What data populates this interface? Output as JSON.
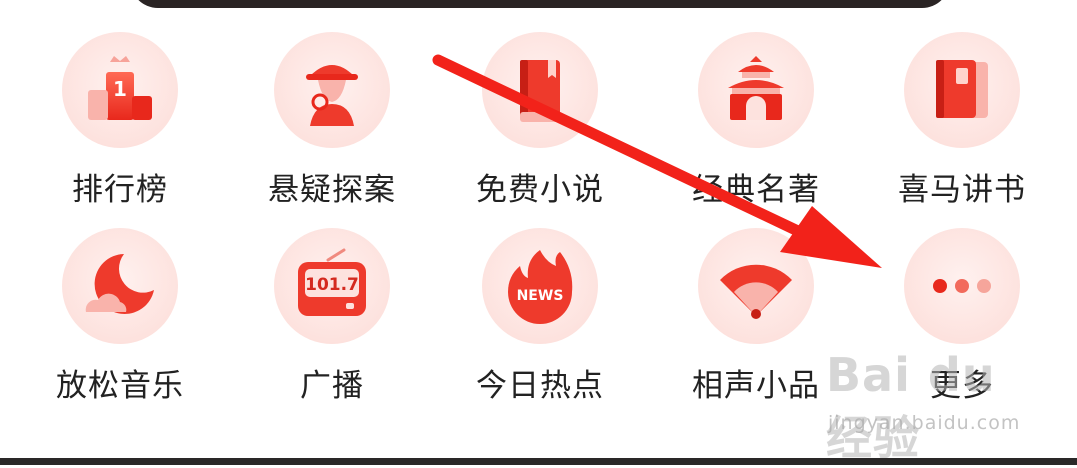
{
  "grid": {
    "items": [
      {
        "label": "排行榜",
        "icon": "podium-icon"
      },
      {
        "label": "悬疑探案",
        "icon": "detective-icon"
      },
      {
        "label": "免费小说",
        "icon": "book-icon"
      },
      {
        "label": "经典名著",
        "icon": "temple-icon"
      },
      {
        "label": "喜马讲书",
        "icon": "notebook-icon"
      },
      {
        "label": "放松音乐",
        "icon": "moon-cloud-icon"
      },
      {
        "label": "广播",
        "icon": "radio-icon"
      },
      {
        "label": "今日热点",
        "icon": "news-flame-icon"
      },
      {
        "label": "相声小品",
        "icon": "fan-icon"
      },
      {
        "label": "更多",
        "icon": "more-dots-icon"
      }
    ]
  },
  "radio_icon_text": "101.7",
  "news_icon_text": "NEWS",
  "podium_number": "1",
  "watermark": {
    "logo": "Bai du 经验",
    "url": "jingyan.baidu.com"
  },
  "colors": {
    "accent": "#ee3a2c",
    "icon_bg": "#fde2de",
    "arrow": "#f2221a",
    "text": "#222222"
  }
}
